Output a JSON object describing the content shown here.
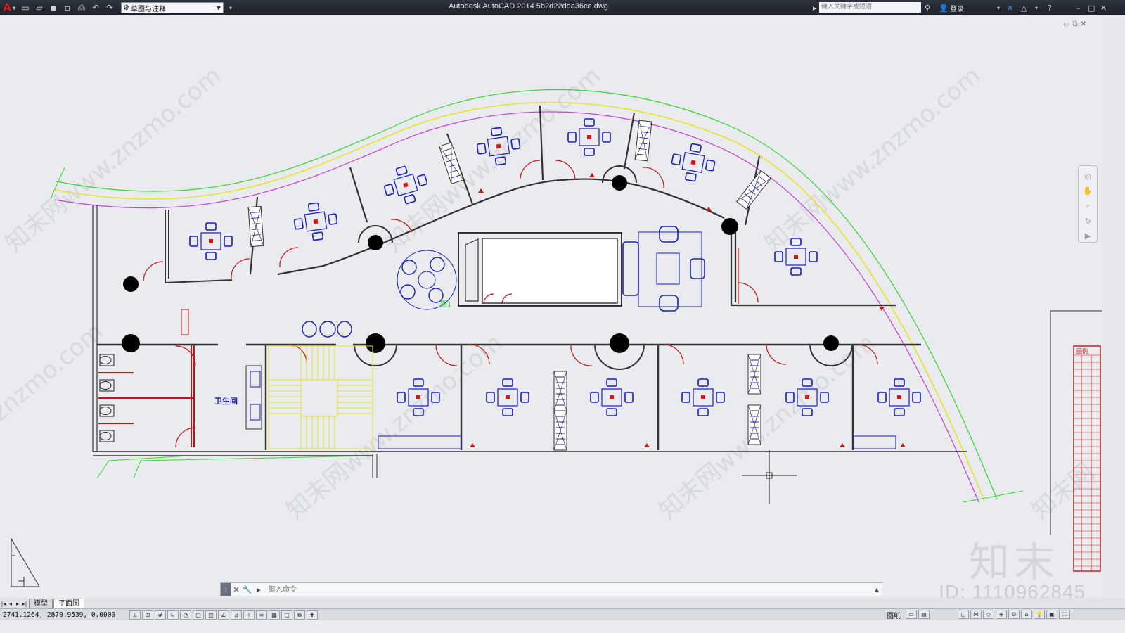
{
  "app": {
    "title": "Autodesk AutoCAD 2014    5b2d22dda36ce.dwg",
    "logo_letter": "A"
  },
  "quick_access": {
    "icons": [
      "new-icon",
      "open-icon",
      "save-icon",
      "saveas-icon",
      "print-icon",
      "undo-icon",
      "redo-icon"
    ],
    "workspace": "草图与注释"
  },
  "search": {
    "placeholder": "键入关键字或短语"
  },
  "account": {
    "login_label": "登录"
  },
  "drawing": {
    "room_label": "卫生间",
    "watermark_text": "znzmo.com",
    "watermark_cn": "知末网",
    "colors": {
      "wall": "#333333",
      "furniture": "#1b1fb5",
      "door": "#c41414",
      "stair": "#e8e22c",
      "site": "#35d435",
      "curb": "#c43fd6"
    },
    "legend_title": "图例"
  },
  "command": {
    "placeholder": "键入命令"
  },
  "layout_tabs": [
    {
      "label": "模型"
    },
    {
      "label": "平面图"
    }
  ],
  "status": {
    "coordinates": "2741.1264, 2870.9539, 0.0000",
    "paper_label": "图纸"
  },
  "watermark": {
    "brand": "知末",
    "id": "ID: 1110962845"
  }
}
